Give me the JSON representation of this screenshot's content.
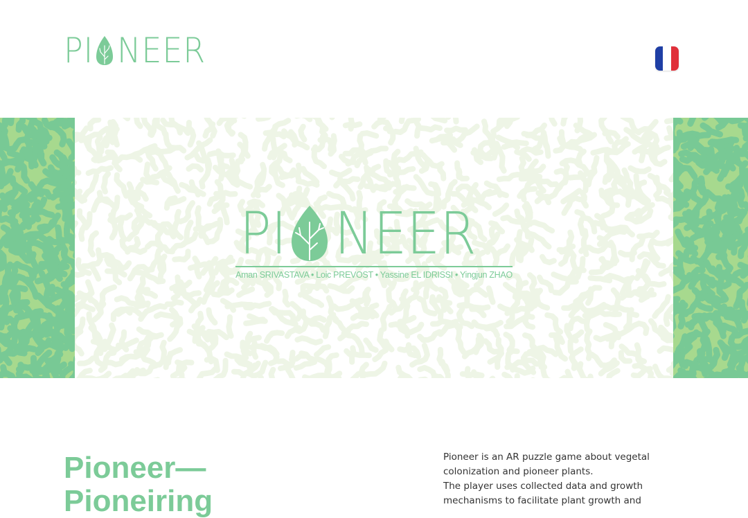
{
  "header": {
    "logo_prefix": "PI",
    "logo_suffix": "NEER",
    "language_flag": "france-flag-icon"
  },
  "banner": {
    "title_prefix": "PI",
    "title_suffix": "NEER",
    "authors": "Aman SRIVASTAVA • Loic PREVOST • Yassine EL IDRISSI • Yingjun ZHAO"
  },
  "intro": {
    "heading": "Pioneer—\nPioneiring",
    "paragraphs": [
      "Pioneer is an AR puzzle game about vegetal colonization and pioneer plants.",
      "The player uses collected data and growth mechanisms to facilitate plant growth and"
    ]
  },
  "colors": {
    "brand_green": "#7ccb98",
    "pattern_light": "#eef5e6",
    "side_band_base": "#a7d98e",
    "side_band_dark": "#78c995",
    "flag_blue": "#1f3fa5",
    "flag_white": "#ffffff",
    "flag_red": "#e0303a",
    "body_text": "#333333"
  }
}
